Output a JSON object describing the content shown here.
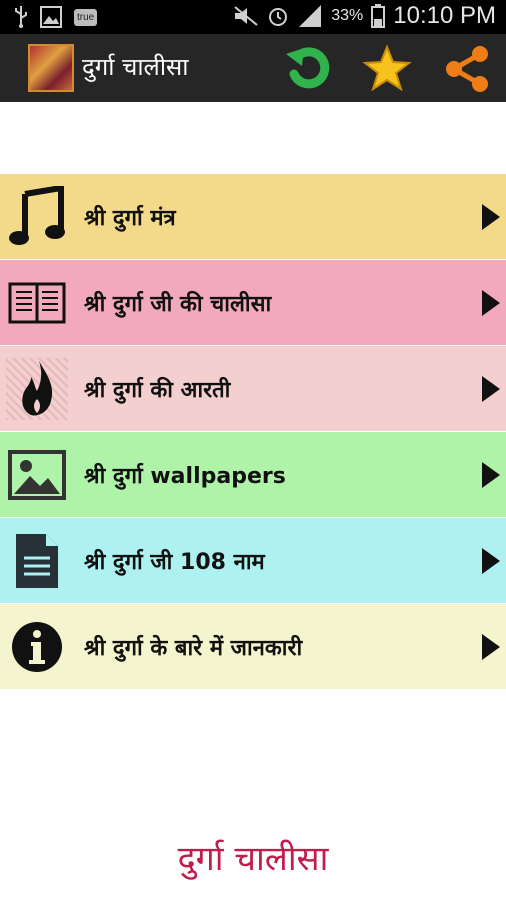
{
  "status_bar": {
    "badge": "true",
    "battery_percent": "33%",
    "time": "10:10 PM",
    "icons": [
      "usb-icon",
      "image-icon",
      "mute-icon",
      "alarm-icon",
      "signal-icon",
      "battery-icon"
    ]
  },
  "app_bar": {
    "title": "दुर्गा चालीसा",
    "actions": [
      "refresh-icon",
      "star-icon",
      "share-icon"
    ],
    "colors": {
      "refresh": "#2fb34a",
      "star": "#f6c21b",
      "share": "#ef7d16",
      "background": "#262626"
    }
  },
  "menu": {
    "items": [
      {
        "label": "श्री दुर्गा मंत्र",
        "icon": "music-note-icon",
        "color": "#f3d98a"
      },
      {
        "label": "श्री दुर्गा जी की चालीसा",
        "icon": "book-icon",
        "color": "#f2a8bd"
      },
      {
        "label": "श्री दुर्गा की आरती",
        "icon": "flame-icon",
        "color": "#f4cfd0"
      },
      {
        "label": "श्री दुर्गा wallpapers",
        "icon": "picture-icon",
        "color": "#aef3a7"
      },
      {
        "label": "श्री दुर्गा जी 108 नाम",
        "icon": "document-icon",
        "color": "#aef1f1"
      },
      {
        "label": "श्री दुर्गा के बारे में जानकारी",
        "icon": "info-icon",
        "color": "#f4f4ce"
      }
    ]
  },
  "footer": {
    "title": "दुर्गा चालीसा",
    "color": "#c11c4c"
  }
}
